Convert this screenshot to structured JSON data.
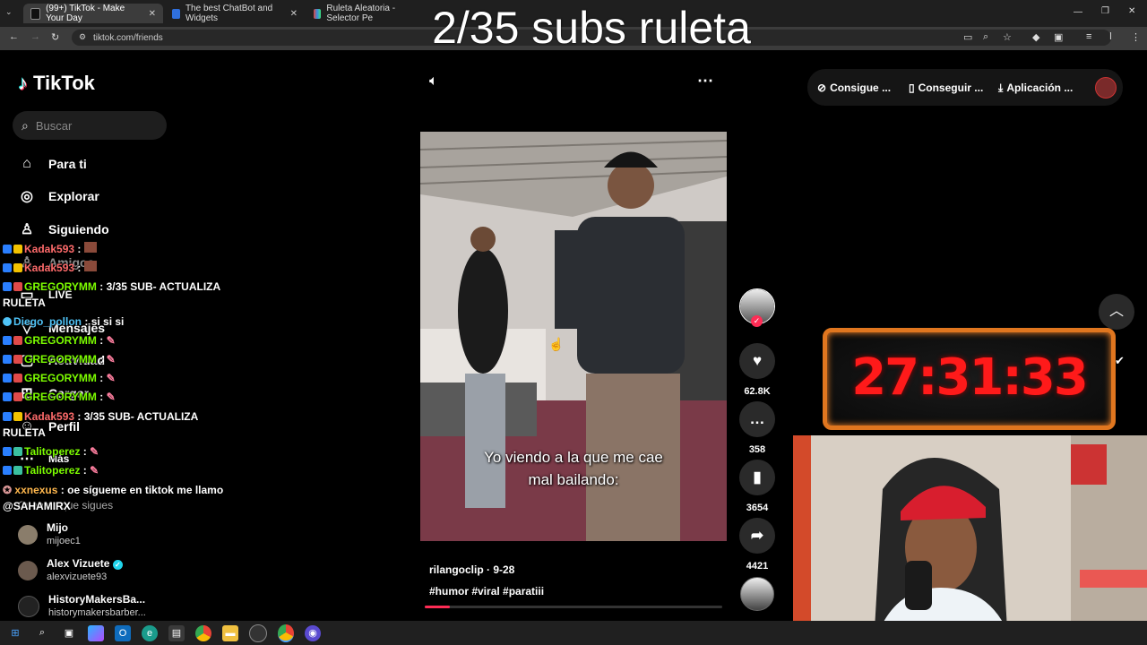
{
  "overlay_title": "2/35 subs ruleta",
  "browser": {
    "tabs": [
      {
        "label": "(99+) TikTok - Make Your Day",
        "color": "#111111"
      },
      {
        "label": "The best ChatBot and Widgets",
        "color": "#2f6fdc"
      },
      {
        "label": "Ruleta Aleatoria - Selector Pe",
        "color": "#e0443a"
      }
    ],
    "url": "tiktok.com/friends"
  },
  "tiktok": {
    "logo": "TikTok",
    "search_placeholder": "Buscar",
    "nav": [
      {
        "label": "Para ti",
        "icon": "home-icon"
      },
      {
        "label": "Explorar",
        "icon": "compass-icon"
      },
      {
        "label": "Siguiendo",
        "icon": "following-icon"
      },
      {
        "label": "Amigos",
        "icon": "friends-icon"
      },
      {
        "label": "LIVE",
        "icon": "live-icon"
      },
      {
        "label": "Mensajes",
        "icon": "messages-icon"
      },
      {
        "label": "Actividad",
        "icon": "activity-icon"
      },
      {
        "label": "Cargar",
        "icon": "upload-icon"
      },
      {
        "label": "Perfil",
        "icon": "profile-icon"
      },
      {
        "label": "Más",
        "icon": "more-icon"
      }
    ],
    "following_header": "Cuentas que sigues",
    "following": [
      {
        "name": "Mijo",
        "handle": "mijoec1"
      },
      {
        "name": "Alex Vizuete",
        "handle": "alexvizuete93",
        "verified": true
      },
      {
        "name": "HistoryMakersBa...",
        "handle": "historymakersbarber..."
      }
    ],
    "top_buttons": [
      "Consigue ...",
      "Conseguir ...",
      "Aplicación ..."
    ],
    "video": {
      "caption_line1": "Yo viendo a la que me cae",
      "caption_line2": "mal bailando:",
      "author": "rilangoclip · 9-28",
      "tags": "#humor #viral #paratiii",
      "likes": "62.8K",
      "comments": "358",
      "saves": "3654",
      "shares": "4421"
    }
  },
  "chat": [
    {
      "user": "Kadak593",
      "sep": " :",
      "msg": "",
      "color": "#ff6b6b"
    },
    {
      "user": "Kadak593",
      "sep": " :",
      "msg": "",
      "color": "#ff6b6b"
    },
    {
      "user": "GREGORYMM",
      "sep": " :",
      "msg": "3/35 SUB- ACTUALIZA",
      "color": "#7CFC00"
    },
    {
      "user": "",
      "sep": "",
      "msg": "RULETA",
      "color": "#ffffff"
    },
    {
      "user": "Diego_pollon",
      "sep": " :",
      "msg": "si si si",
      "color": "#4fc3f7"
    },
    {
      "user": "GREGORYMM",
      "sep": " :",
      "msg": "",
      "color": "#7CFC00"
    },
    {
      "user": "GREGORYMM",
      "sep": " :",
      "msg": "",
      "color": "#7CFC00"
    },
    {
      "user": "GREGORYMM",
      "sep": " :",
      "msg": "",
      "color": "#7CFC00"
    },
    {
      "user": "GREGORYMM",
      "sep": " :",
      "msg": "",
      "color": "#7CFC00"
    },
    {
      "user": "Kadak593",
      "sep": " :",
      "msg": "3/35 SUB- ACTUALIZA",
      "color": "#ff6b6b"
    },
    {
      "user": "",
      "sep": "",
      "msg": "RULETA",
      "color": "#ffffff"
    },
    {
      "user": "Talitoperez",
      "sep": " :",
      "msg": "",
      "color": "#7CFC00"
    },
    {
      "user": "Talitoperez",
      "sep": " :",
      "msg": "",
      "color": "#7CFC00"
    },
    {
      "user": "xxnexus",
      "sep": " :",
      "msg": "oe sígueme en tiktok me llamo",
      "color": "#ffb74d"
    },
    {
      "user": "",
      "sep": "",
      "msg": "@SAHAMIRX",
      "color": "#ffffff"
    }
  ],
  "timer": "27:31:33",
  "colors": {
    "accent": "#fe2c55",
    "timer_red": "#ff1a1a"
  }
}
